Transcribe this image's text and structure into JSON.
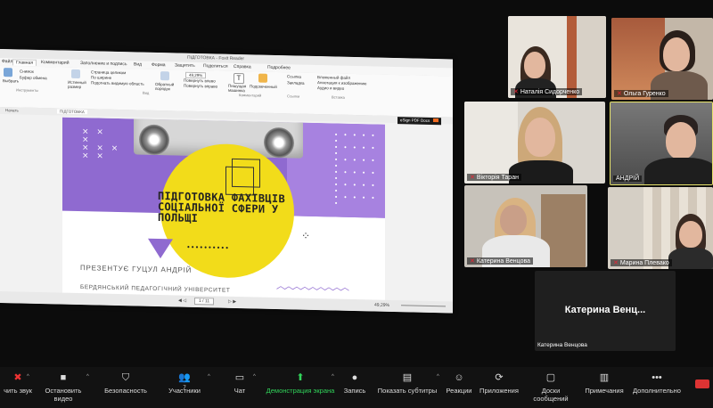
{
  "share": {
    "window_title": "ПІДГОТОВКА - Foxit Reader",
    "tabs": [
      "Файл",
      "Главная",
      "Комментарий",
      "Заполнение и подпись",
      "Вид",
      "Форма",
      "Защитить",
      "Поделиться",
      "Справка",
      "Подробнее"
    ],
    "active_tab": "Главная",
    "ribbon": {
      "tool_select": "Выбрать",
      "group_tools": "Инструменты",
      "snapshot": "Снимок",
      "clipboard": "Буфер обмена",
      "actual_size": "Истинный размер",
      "fit_page": "Страница целиком",
      "fit_width": "По ширине",
      "fit_visible": "Подогнать видимую область",
      "group_view": "Вид",
      "reflow": "Обратный порядок",
      "zoom": "49,29%",
      "rotate_left": "Повернуть влево",
      "rotate_right": "Повернуть вправо",
      "typewriter": "Пишущая машинка",
      "highlight": "Подсвеченный",
      "group_comment": "Комментарий",
      "link": "Ссылка",
      "bookmark": "Закладка",
      "group_links": "Ссылки",
      "file_attach": "Вложенный файл",
      "image_annot": "Аннотация к изображению",
      "audio_video": "Аудио и видео",
      "group_insert": "Вставка"
    },
    "nav_start": "Начать",
    "nav_doc": "ПІДГОТОВКА",
    "esign_label": "eSign PDF Docs",
    "page_indicator": "1 / 11",
    "status_zoom": "49,29%",
    "slide": {
      "title": "ПІДГОТОВКА ФАХІВЦІВ СОЦІАЛЬНОЇ СФЕРИ У ПОЛЬЩІ",
      "author": "ПРЕЗЕНТУЄ ГУЦУЛ АНДРІЙ",
      "university": "БЕРДЯНСЬКИЙ ПЕДАГОГІЧНИЙ УНІВЕРСИТЕТ",
      "accent_purple": "#8f6ad0",
      "accent_yellow": "#f2dc1a"
    }
  },
  "participants": [
    {
      "name": "Наталія Сидорченко",
      "muted": true
    },
    {
      "name": "Ольга Гуренко",
      "muted": true
    },
    {
      "name": "Вікторія Таран",
      "muted": true
    },
    {
      "name": "АНДРІЙ",
      "muted": false,
      "active": true
    },
    {
      "name": "Катерина Венцова",
      "muted": true
    },
    {
      "name": "Марина Плевако",
      "muted": true
    },
    {
      "name": "Катерина Венцова",
      "muted": false,
      "video_off": true,
      "display": "Катерина Венц..."
    }
  ],
  "toolbar": {
    "mute": "чить звук",
    "stop_video": "Остановить видео",
    "security": "Безопасность",
    "participants": "Участники",
    "participants_count": "7",
    "chat": "Чат",
    "share_screen": "Демонстрация экрана",
    "record": "Запись",
    "subtitles": "Показать субтитры",
    "reactions": "Реакции",
    "apps": "Приложения",
    "whiteboards": "Доски сообщений",
    "notes": "Примечания",
    "more": "Дополнительно",
    "green": "#31d35a"
  }
}
